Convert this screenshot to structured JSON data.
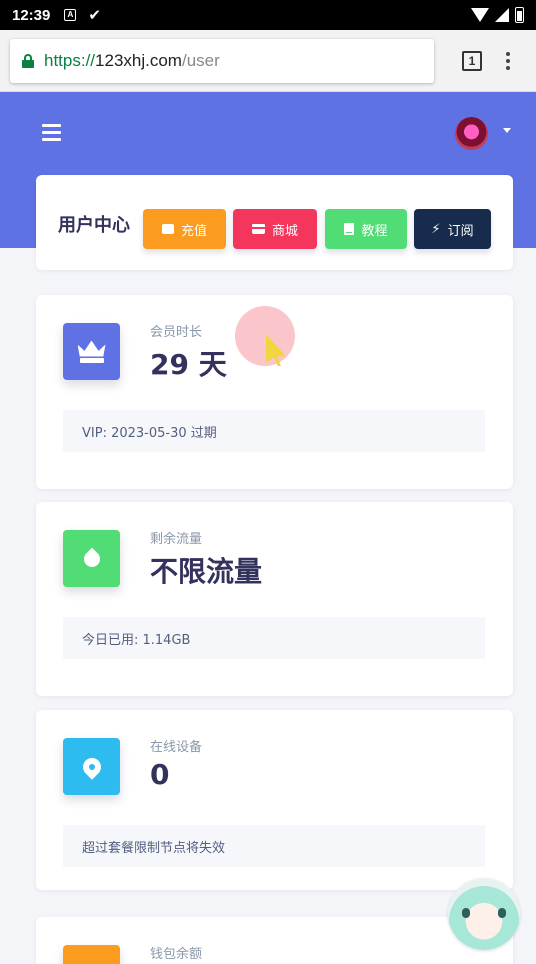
{
  "status_bar": {
    "time": "12:39",
    "notification_badge": "A"
  },
  "browser": {
    "url_scheme": "https://",
    "url_host": "123xhj.com",
    "url_path": "/user",
    "tab_count": "1"
  },
  "colors": {
    "hero": "#5e72e4",
    "recharge": "#fb9b1f",
    "shop": "#f5365c",
    "tutorial": "#52dc76",
    "subscribe": "#172b4d",
    "crown_box": "#5e72e4",
    "traffic_box": "#52dc76",
    "device_box": "#2dbbf0",
    "wallet_box": "#fb9b1f"
  },
  "header": {
    "title": "用户中心",
    "buttons": {
      "recharge": "充值",
      "shop": "商城",
      "tutorial": "教程",
      "subscribe": "订阅"
    }
  },
  "stats": {
    "membership": {
      "label": "会员时长",
      "value": "29 天",
      "footer": "VIP: 2023-05-30 过期",
      "icon": "crown-icon"
    },
    "traffic": {
      "label": "剩余流量",
      "value": "不限流量",
      "footer": "今日已用: 1.14GB",
      "icon": "droplet-icon"
    },
    "devices": {
      "label": "在线设备",
      "value": "0",
      "footer": "超过套餐限制节点将失效",
      "icon": "location-pin-icon"
    },
    "wallet": {
      "label": "钱包余额",
      "icon": "wallet-icon"
    }
  }
}
